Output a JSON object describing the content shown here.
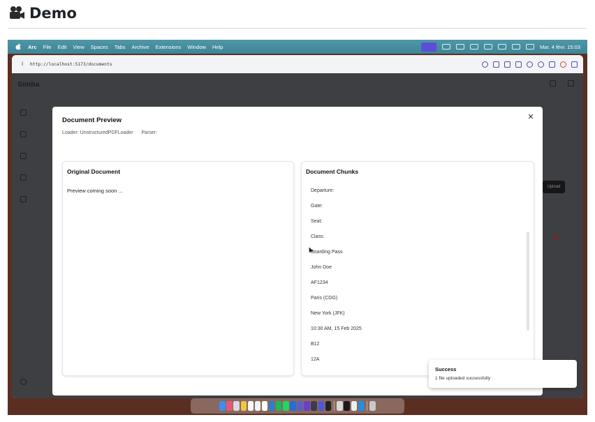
{
  "page": {
    "title": "Demo"
  },
  "menubar": {
    "app_name": "Arc",
    "items": [
      "File",
      "Edit",
      "View",
      "Spaces",
      "Tabs",
      "Archive",
      "Extensions",
      "Window",
      "Help"
    ],
    "clock": "Mar. 4 févr.  15:03"
  },
  "browser": {
    "url": "http://localhost:5173/documents"
  },
  "app": {
    "brand": "Simba",
    "background_button_label": "Upload"
  },
  "modal": {
    "title": "Document Preview",
    "loader_label": "Loader: UnstructuredPDFLoader",
    "parser_label": "Parser:",
    "left_panel": {
      "title": "Original Document",
      "text": "Preview coming soon ..."
    },
    "right_panel": {
      "title": "Document Chunks",
      "chunks": [
        "Departure:",
        "Gate:",
        "Seat:",
        "Class:",
        "Boarding Pass",
        "John Doe",
        "AF1234",
        "Paris (CDG)",
        "New York (JFK)",
        "10:30 AM, 15 Feb 2025",
        "B12",
        "12A"
      ]
    }
  },
  "toast": {
    "title": "Success",
    "message": "1 file uploaded successfully"
  },
  "dock": {
    "apps": [
      {
        "name": "finder",
        "color": "#3d8ef0"
      },
      {
        "name": "arc",
        "color": "#e8577a"
      },
      {
        "name": "launchpad",
        "color": "#d8d8e0"
      },
      {
        "name": "notes",
        "color": "#f4c542"
      },
      {
        "name": "calendar",
        "color": "#fbfbfb"
      },
      {
        "name": "music",
        "color": "#f2f2f2"
      },
      {
        "name": "notion",
        "color": "#ffffff"
      },
      {
        "name": "vscode",
        "color": "#2a7fd4"
      },
      {
        "name": "spotify",
        "color": "#1db954"
      },
      {
        "name": "whatsapp",
        "color": "#25d366"
      },
      {
        "name": "word",
        "color": "#2b6ad6"
      },
      {
        "name": "teams",
        "color": "#5b5fc7"
      },
      {
        "name": "obsidian",
        "color": "#6b3fc4"
      },
      {
        "name": "cursor",
        "color": "#3c3c4a"
      },
      {
        "name": "linear",
        "color": "#4f57d8"
      },
      {
        "name": "terminal",
        "color": "#222222"
      },
      {
        "name": "stack",
        "color": "#d9d9d9"
      },
      {
        "name": "github",
        "color": "#1a1a1a"
      },
      {
        "name": "claude",
        "color": "#f0efe9"
      },
      {
        "name": "docker",
        "color": "#1d91e6"
      },
      {
        "name": "trash",
        "color": "#c9c9c9"
      }
    ]
  }
}
